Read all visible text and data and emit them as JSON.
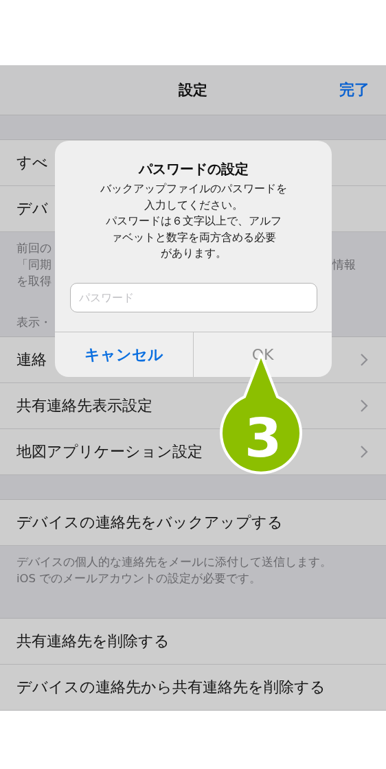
{
  "nav_bar": {
    "title": "設定",
    "done": "完了"
  },
  "list": [
    {
      "kind": "gap"
    },
    {
      "kind": "row",
      "label": "すべ",
      "chevron": false
    },
    {
      "kind": "row",
      "label": "デバ",
      "chevron": false
    },
    {
      "kind": "note",
      "lines": [
        {
          "left": "前回の"
        },
        {
          "left": "「同期",
          "right": "情報"
        },
        {
          "left": "を取得"
        }
      ],
      "header": "表示・"
    },
    {
      "kind": "row",
      "label": "連絡",
      "chevron": true
    },
    {
      "kind": "row",
      "label": "共有連絡先表示設定",
      "chevron": true
    },
    {
      "kind": "row",
      "label": "地図アプリケーション設定",
      "chevron": true
    },
    {
      "kind": "gap"
    },
    {
      "kind": "row",
      "label": "デバイスの連絡先をバックアップする",
      "chevron": false
    },
    {
      "kind": "note",
      "lines": [
        {
          "left": "デバイスの個人的な連絡先をメールに添付して送信します。"
        },
        {
          "left": "iOS でのメールアカウントの設定が必要です。"
        }
      ]
    },
    {
      "kind": "row",
      "label": "共有連絡先を削除する",
      "chevron": false
    },
    {
      "kind": "row",
      "label": "デバイスの連絡先から共有連絡先を削除する",
      "chevron": false
    }
  ],
  "alert": {
    "title": "パスワードの設定",
    "message": [
      "バックアップファイルのパスワードを",
      "入力してください。",
      "パスワードは６文字以上で、アルフ",
      "ァベットと数字を両方含める必要",
      "があります。"
    ],
    "field": {
      "placeholder": "パスワード"
    },
    "buttons": [
      {
        "label": "キャンセル",
        "disabled": false
      },
      {
        "label": "OK",
        "disabled": true
      }
    ]
  },
  "step_marker": "3"
}
